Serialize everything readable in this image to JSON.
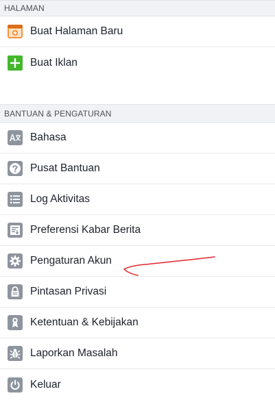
{
  "sections": {
    "halaman": {
      "title": "HALAMAN",
      "items": [
        {
          "label": "Buat Halaman Baru",
          "icon": "create-page-icon"
        },
        {
          "label": "Buat Iklan",
          "icon": "plus-icon"
        }
      ]
    },
    "bantuan": {
      "title": "BANTUAN & PENGATURAN",
      "items": [
        {
          "label": "Bahasa",
          "icon": "language-icon"
        },
        {
          "label": "Pusat Bantuan",
          "icon": "question-icon"
        },
        {
          "label": "Log Aktivitas",
          "icon": "list-icon"
        },
        {
          "label": "Preferensi Kabar Berita",
          "icon": "news-feed-icon"
        },
        {
          "label": "Pengaturan Akun",
          "icon": "gear-icon"
        },
        {
          "label": "Pintasan Privasi",
          "icon": "lock-icon"
        },
        {
          "label": "Ketentuan & Kebijakan",
          "icon": "terms-icon"
        },
        {
          "label": "Laporkan Masalah",
          "icon": "bug-icon"
        },
        {
          "label": "Keluar",
          "icon": "power-icon"
        }
      ]
    }
  },
  "colors": {
    "section_bg": "#f1f2f5",
    "icon_gray": "#8d949e",
    "icon_orange": "#f7923b",
    "icon_green": "#42b72a",
    "annotation_red": "#e0262a"
  }
}
